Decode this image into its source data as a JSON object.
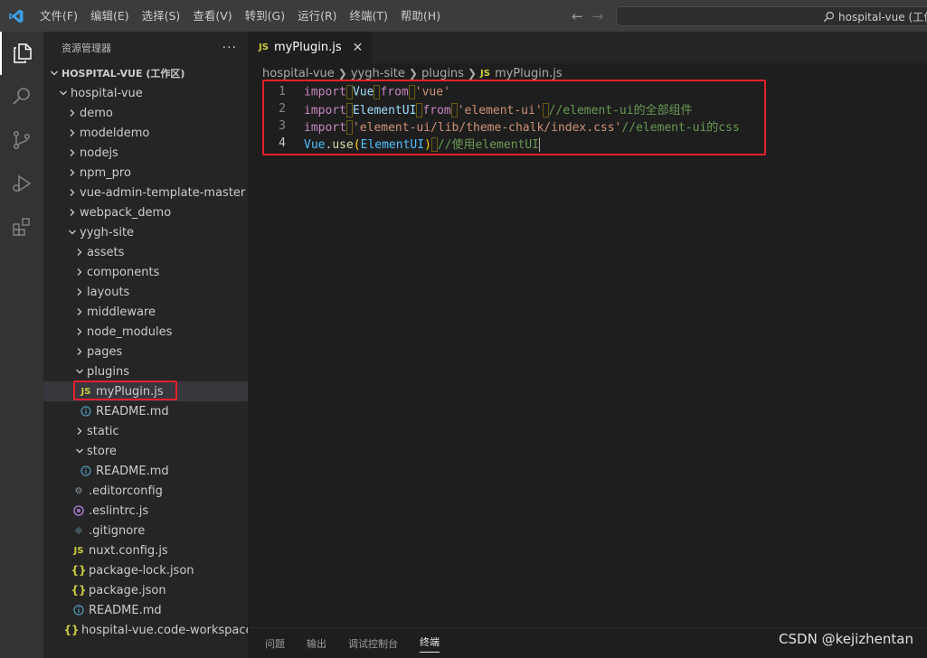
{
  "menu": [
    "文件(F)",
    "编辑(E)",
    "选择(S)",
    "查看(V)",
    "转到(G)",
    "运行(R)",
    "终端(T)",
    "帮助(H)"
  ],
  "command_center": "hospital-vue (工作",
  "sidebar": {
    "title": "资源管理器",
    "more": "···",
    "root": "HOSPITAL-VUE (工作区)",
    "project": "hospital-vue",
    "folders_top": [
      "demo",
      "modeldemo",
      "nodejs",
      "npm_pro",
      "vue-admin-template-master",
      "webpack_demo"
    ],
    "site": "yygh-site",
    "site_folders": [
      "assets",
      "components",
      "layouts",
      "middleware",
      "node_modules",
      "pages"
    ],
    "plugins": "plugins",
    "plugins_files": [
      "myPlugin.js",
      "README.md"
    ],
    "static": "static",
    "store": "store",
    "store_files": [
      "README.md"
    ],
    "root_files": [
      ".editorconfig",
      ".eslintrc.js",
      ".gitignore",
      "nuxt.config.js",
      "package-lock.json",
      "package.json",
      "README.md"
    ],
    "workspace_file": "hospital-vue.code-workspace"
  },
  "editor": {
    "tab_icon": "JS",
    "tab_label": "myPlugin.js",
    "breadcrumb": [
      "hospital-vue",
      "yygh-site",
      "plugins",
      "myPlugin.js"
    ],
    "line_numbers": [
      "1",
      "2",
      "3",
      "4"
    ],
    "code": {
      "l1_kw": "import",
      "l1_id": "Vue",
      "l1_from": "from",
      "l1_str": "'vue'",
      "l2_kw": "import",
      "l2_id": "ElementUI",
      "l2_from": "from",
      "l2_str": "'element-ui'",
      "l2_cmt": "//element-ui的全部组件",
      "l3_kw": "import",
      "l3_str": "'element-ui/lib/theme-chalk/index.css'",
      "l3_cmt": "//element-ui的css",
      "l4_obj": "Vue",
      "l4_dot": ".",
      "l4_fn": "use",
      "l4_open": "(",
      "l4_arg": "ElementUI",
      "l4_close": ")",
      "l4_cmt": "//使用elementUI"
    }
  },
  "panel_tabs": [
    "问题",
    "输出",
    "调试控制台",
    "终端"
  ],
  "watermark": "CSDN @kejizhentan",
  "colors": {
    "highlight_box": "#e5202d",
    "accent": "#007acc"
  }
}
